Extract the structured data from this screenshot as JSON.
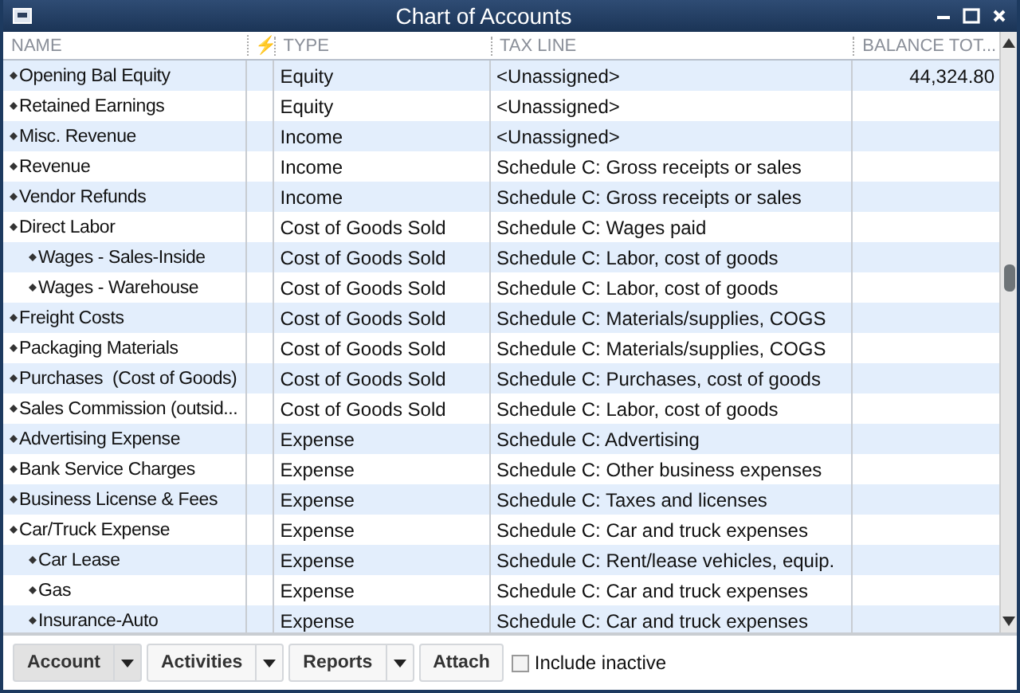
{
  "window": {
    "title": "Chart of Accounts"
  },
  "table": {
    "columns": [
      "NAME",
      "⚡",
      "TYPE",
      "TAX LINE",
      "BALANCE TOT..."
    ],
    "rows": [
      {
        "name": "Opening Bal Equity",
        "type": "Equity",
        "tax_line": "<Unassigned>",
        "balance": "44,324.80"
      },
      {
        "name": "Retained Earnings",
        "type": "Equity",
        "tax_line": "<Unassigned>"
      },
      {
        "name": "Misc. Revenue",
        "type": "Income",
        "tax_line": "<Unassigned>"
      },
      {
        "name": "Revenue",
        "type": "Income",
        "tax_line": "Schedule C: Gross receipts or sales"
      },
      {
        "name": "Vendor Refunds",
        "type": "Income",
        "tax_line": "Schedule C: Gross receipts or sales"
      },
      {
        "name": "Direct Labor",
        "type": "Cost of Goods Sold",
        "tax_line": "Schedule C: Wages paid",
        "children": [
          {
            "name": "Wages - Sales-Inside",
            "type": "Cost of Goods Sold",
            "tax_line": "Schedule C: Labor, cost of goods"
          },
          {
            "name": "Wages - Warehouse",
            "type": "Cost of Goods Sold",
            "tax_line": "Schedule C: Labor, cost of goods"
          }
        ]
      },
      {
        "name": "Freight Costs",
        "type": "Cost of Goods Sold",
        "tax_line": "Schedule C: Materials/supplies, COGS"
      },
      {
        "name": "Packaging Materials",
        "type": "Cost of Goods Sold",
        "tax_line": "Schedule C: Materials/supplies, COGS"
      },
      {
        "name": "Purchases  (Cost of Goods)",
        "type": "Cost of Goods Sold",
        "tax_line": "Schedule C: Purchases, cost of goods"
      },
      {
        "name": "Sales Commission (outsid...",
        "type": "Cost of Goods Sold",
        "tax_line": "Schedule C: Labor, cost of goods"
      },
      {
        "name": "Advertising Expense",
        "type": "Expense",
        "tax_line": "Schedule C: Advertising"
      },
      {
        "name": "Bank Service Charges",
        "type": "Expense",
        "tax_line": "Schedule C: Other business expenses"
      },
      {
        "name": "Business License & Fees",
        "type": "Expense",
        "tax_line": "Schedule C: Taxes and licenses"
      },
      {
        "name": "Car/Truck Expense",
        "type": "Expense",
        "tax_line": "Schedule C: Car and truck expenses",
        "children": [
          {
            "name": "Car Lease",
            "type": "Expense",
            "tax_line": "Schedule C: Rent/lease vehicles, equip."
          },
          {
            "name": "Gas",
            "type": "Expense",
            "tax_line": "Schedule C: Car and truck expenses"
          },
          {
            "name": "Insurance-Auto",
            "type": "Expense",
            "tax_line": "Schedule C: Car and truck expenses"
          }
        ]
      }
    ]
  },
  "toolbar": {
    "menus": [
      {
        "label": "Account",
        "dropdown": true
      },
      {
        "label": "Activities",
        "dropdown": true
      },
      {
        "label": "Reports",
        "dropdown": true
      },
      {
        "label": "Attach",
        "dropdown": false
      }
    ],
    "include_inactive": {
      "label": "Include inactive",
      "checked": false
    }
  }
}
